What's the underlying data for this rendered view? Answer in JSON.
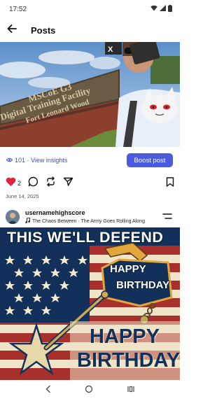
{
  "status_bar": {
    "time": "17:52",
    "icons": [
      "wifi-icon",
      "signal-icon",
      "battery-icon"
    ]
  },
  "header": {
    "title": "Posts",
    "back_icon": "arrow-left-icon"
  },
  "post1": {
    "sign_text": [
      "MSCoE G3",
      "Digital Training Facility",
      "Fort Leonard Wood"
    ],
    "insights": {
      "icon": "eye-icon",
      "text": "101 · View insights"
    },
    "boost_label": "Boost post",
    "actions": {
      "like_count": "2",
      "liked": true,
      "icons": [
        "heart-icon",
        "comment-icon",
        "repost-icon",
        "share-icon",
        "bookmark-icon"
      ]
    },
    "date": "June 14, 2025"
  },
  "post2": {
    "username": "usernamehighscore",
    "music": "The Chaos Between · The Army Goes Rolling Along",
    "music_icon": "music-note-icon",
    "menu_icon": "menu-icon",
    "graphic": {
      "headline": "THIS WE'LL DEFEND",
      "badge_line1": "HAPPY",
      "badge_line2": "BIRTHDAY",
      "big_line1": "HAPPY",
      "big_line2": "BIRTHDAY"
    }
  },
  "nav_bar": {
    "icons": [
      "back-nav-icon",
      "home-nav-icon",
      "recents-nav-icon"
    ]
  },
  "colors": {
    "accent": "#4a5be0",
    "link": "#3d4fc4",
    "heart": "#e0243b",
    "navy": "#12305a",
    "stripe_red": "#a8302b"
  }
}
